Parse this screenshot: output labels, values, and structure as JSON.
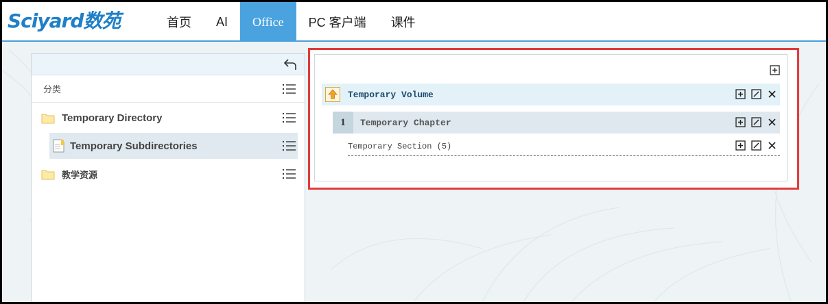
{
  "brand": {
    "logo_text": "Sciyard数苑"
  },
  "nav": [
    {
      "label": "首页",
      "active": false
    },
    {
      "label": "AI",
      "active": false
    },
    {
      "label": "Office",
      "active": true
    },
    {
      "label": "PC 客户端",
      "active": false
    },
    {
      "label": "课件",
      "active": false
    }
  ],
  "sidebar": {
    "category_label": "分类",
    "items": [
      {
        "label": "Temporary Directory",
        "icon": "folder-icon",
        "selected": false
      },
      {
        "label": "Temporary Subdirectories",
        "icon": "document-icon",
        "selected": true
      },
      {
        "label": "教学资源",
        "icon": "folder-icon",
        "selected": false
      }
    ]
  },
  "content": {
    "volume": {
      "title": "Temporary Volume"
    },
    "chapter": {
      "number": "1",
      "title": "Temporary Chapter"
    },
    "section": {
      "title": "Temporary Section (5)"
    }
  },
  "colors": {
    "accent": "#4aa3df",
    "highlight_box": "#e03a3a",
    "volume_row": "#e3f2f9",
    "chapter_row": "#dfe8ee"
  }
}
